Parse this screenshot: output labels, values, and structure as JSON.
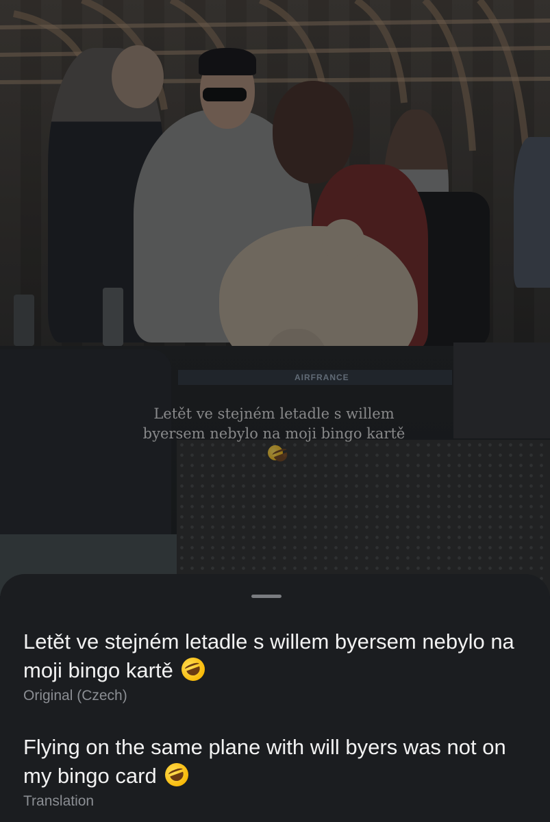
{
  "media": {
    "overlay_caption": "Letět ve stejném letadle s willem byersem nebylo na moji bingo kartě",
    "signage": "AIRFRANCE"
  },
  "translation_sheet": {
    "original_text": "Letět ve stejném letadle s willem byersem nebylo na moji bingo kartě",
    "original_label": "Original (Czech)",
    "translated_text": "Flying on the same plane with will byers was not on my bingo card",
    "translated_label": "Translation",
    "emoji": "rolling-on-floor-laughing-emoji"
  },
  "colors": {
    "sheet_background": "#1b1d20",
    "primary_text": "#f2f2f2",
    "secondary_text": "#8b8e93",
    "grabber": "#7a7c80"
  }
}
